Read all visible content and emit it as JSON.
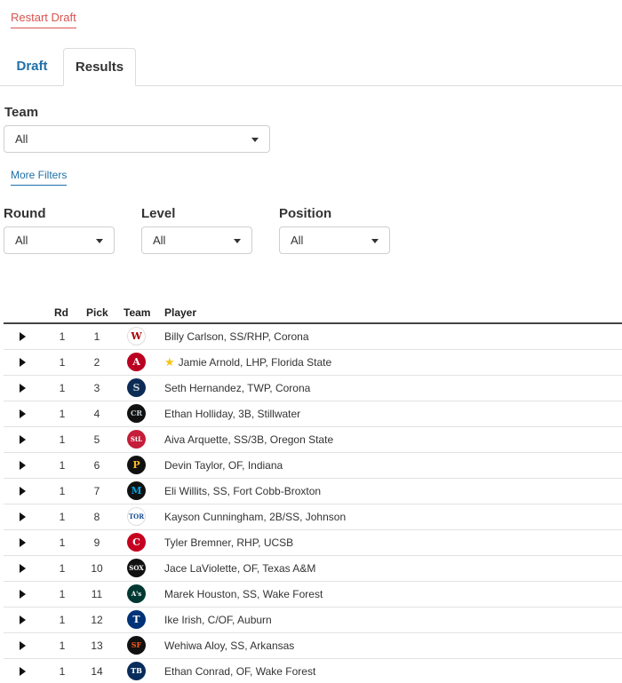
{
  "header": {
    "restart_label": "Restart Draft"
  },
  "tabs": [
    {
      "label": "Draft",
      "active": false
    },
    {
      "label": "Results",
      "active": true
    }
  ],
  "filters": {
    "team_label": "Team",
    "team_value": "All",
    "more_filters_label": "More Filters",
    "round_label": "Round",
    "round_value": "All",
    "level_label": "Level",
    "level_value": "All",
    "position_label": "Position",
    "position_value": "All"
  },
  "table": {
    "columns": [
      "Rd",
      "Pick",
      "Team",
      "Player"
    ],
    "rows": [
      {
        "rd": "1",
        "pick": "1",
        "team_logo": "W",
        "logo_color": "#ffffff",
        "logo_fg": "#ab0003",
        "starred": false,
        "player": "Billy Carlson, SS/RHP, Corona"
      },
      {
        "rd": "1",
        "pick": "2",
        "team_logo": "A",
        "logo_color": "#ba0021",
        "logo_fg": "#ffffff",
        "starred": true,
        "player": "Jamie Arnold, LHP, Florida State"
      },
      {
        "rd": "1",
        "pick": "3",
        "team_logo": "S",
        "logo_color": "#0c2c56",
        "logo_fg": "#c4ced4",
        "starred": false,
        "player": "Seth Hernandez, TWP, Corona"
      },
      {
        "rd": "1",
        "pick": "4",
        "team_logo": "CR",
        "logo_color": "#111111",
        "logo_fg": "#c4ced4",
        "starred": false,
        "player": "Ethan Holliday, 3B, Stillwater"
      },
      {
        "rd": "1",
        "pick": "5",
        "team_logo": "StL",
        "logo_color": "#c41e3a",
        "logo_fg": "#ffffff",
        "starred": false,
        "player": "Aiva Arquette, SS/3B, Oregon State"
      },
      {
        "rd": "1",
        "pick": "6",
        "team_logo": "P",
        "logo_color": "#111111",
        "logo_fg": "#fdb827",
        "starred": false,
        "player": "Devin Taylor, OF, Indiana"
      },
      {
        "rd": "1",
        "pick": "7",
        "team_logo": "M",
        "logo_color": "#111111",
        "logo_fg": "#00a3e0",
        "starred": false,
        "player": "Eli Willits, SS, Fort Cobb-Broxton"
      },
      {
        "rd": "1",
        "pick": "8",
        "team_logo": "TOR",
        "logo_color": "#ffffff",
        "logo_fg": "#134a8e",
        "starred": false,
        "player": "Kayson Cunningham, 2B/SS, Johnson"
      },
      {
        "rd": "1",
        "pick": "9",
        "team_logo": "C",
        "logo_color": "#c6011f",
        "logo_fg": "#ffffff",
        "starred": false,
        "player": "Tyler Bremner, RHP, UCSB"
      },
      {
        "rd": "1",
        "pick": "10",
        "team_logo": "SOX",
        "logo_color": "#111111",
        "logo_fg": "#ffffff",
        "starred": false,
        "player": "Jace LaViolette, OF, Texas A&M"
      },
      {
        "rd": "1",
        "pick": "11",
        "team_logo": "A's",
        "logo_color": "#003831",
        "logo_fg": "#ffffff",
        "starred": false,
        "player": "Marek Houston, SS, Wake Forest"
      },
      {
        "rd": "1",
        "pick": "12",
        "team_logo": "T",
        "logo_color": "#003278",
        "logo_fg": "#ffffff",
        "starred": false,
        "player": "Ike Irish, C/OF, Auburn"
      },
      {
        "rd": "1",
        "pick": "13",
        "team_logo": "SF",
        "logo_color": "#111111",
        "logo_fg": "#fd5a1e",
        "starred": false,
        "player": "Wehiwa Aloy, SS, Arkansas"
      },
      {
        "rd": "1",
        "pick": "14",
        "team_logo": "TB",
        "logo_color": "#092c5c",
        "logo_fg": "#ffffff",
        "starred": false,
        "player": "Ethan Conrad, OF, Wake Forest"
      }
    ]
  },
  "icons": {
    "expand": "caret-right-icon",
    "dropdown": "chevron-down-icon",
    "favorite": "star-icon"
  }
}
